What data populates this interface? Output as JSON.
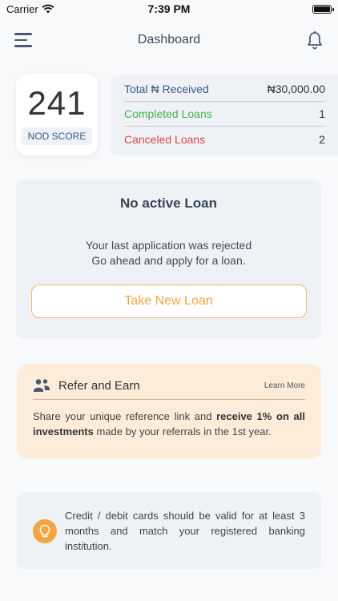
{
  "status_bar": {
    "carrier": "Carrier",
    "time": "7:39 PM"
  },
  "nav": {
    "title": "Dashboard"
  },
  "score": {
    "value": "241",
    "label": "NOD SCORE"
  },
  "stats": [
    {
      "label": "Total ₦ Received",
      "value": "₦30,000.00",
      "color": "#3a5a84"
    },
    {
      "label": "Completed Loans",
      "value": "1",
      "color": "#45b24a"
    },
    {
      "label": "Canceled Loans",
      "value": "2",
      "color": "#d84848"
    }
  ],
  "loan": {
    "title": "No active Loan",
    "message_line1": "Your last application was rejected",
    "message_line2": "Go ahead and apply for a loan.",
    "button": "Take New Loan"
  },
  "refer": {
    "title": "Refer and Earn",
    "learn_more": "Learn More",
    "text_part1": "Share your unique reference link and ",
    "text_bold1": "receive 1% on all investments",
    "text_part2": " made by your referrals in the 1st year."
  },
  "info": {
    "text": "Credit / debit cards should be valid for at least 3 months and match your registered banking institution."
  },
  "colors": {
    "accent": "#f0a64a",
    "icon_orange": "#f2a541"
  }
}
